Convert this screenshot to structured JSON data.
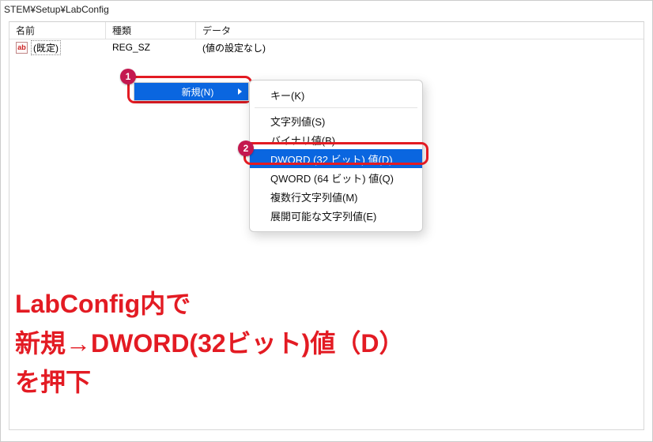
{
  "address_bar": "STEM¥Setup¥LabConfig",
  "columns": {
    "name": "名前",
    "type": "種類",
    "data": "データ"
  },
  "row0": {
    "icon_label": "ab",
    "name": "(既定)",
    "type": "REG_SZ",
    "data": "(値の設定なし)"
  },
  "ctx_menu": {
    "new": "新規(N)"
  },
  "submenu": {
    "key": "キー(K)",
    "string": "文字列値(S)",
    "binary": "バイナリ値(B)",
    "dword": "DWORD (32 ビット) 値(D)",
    "qword": "QWORD (64 ビット) 値(Q)",
    "multi": "複数行文字列値(M)",
    "expand": "展開可能な文字列値(E)"
  },
  "badges": {
    "b1": "1",
    "b2": "2"
  },
  "caption": "LabConfig内で\n新規→DWORD(32ビット)値（D）\nを押下"
}
